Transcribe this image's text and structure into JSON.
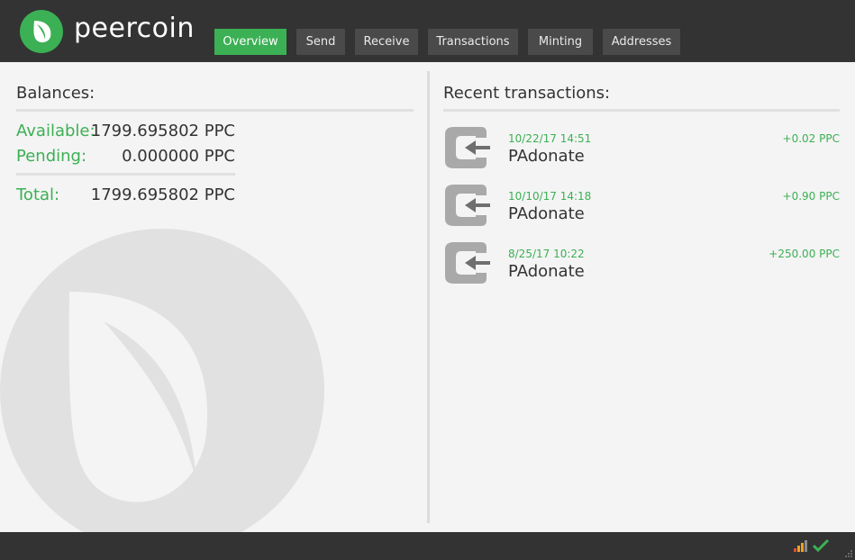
{
  "app": {
    "brand": "peercoin"
  },
  "nav": {
    "tabs": [
      {
        "label": "Overview",
        "active": true
      },
      {
        "label": "Send",
        "active": false
      },
      {
        "label": "Receive",
        "active": false
      },
      {
        "label": "Transactions",
        "active": false
      },
      {
        "label": "Minting",
        "active": false
      },
      {
        "label": "Addresses",
        "active": false
      }
    ]
  },
  "balances": {
    "title": "Balances:",
    "available_label": "Available:",
    "available_value": "1799.695802 PPC",
    "pending_label": "Pending:",
    "pending_value": "0.000000 PPC",
    "total_label": "Total:",
    "total_value": "1799.695802 PPC"
  },
  "recent": {
    "title": "Recent transactions:",
    "items": [
      {
        "date": "10/22/17 14:51",
        "label": "PAdonate",
        "amount": "+0.02 PPC",
        "icon": "receive-icon"
      },
      {
        "date": "10/10/17 14:18",
        "label": "PAdonate",
        "amount": "+0.90 PPC",
        "icon": "receive-icon"
      },
      {
        "date": "8/25/17 10:22",
        "label": "PAdonate",
        "amount": "+250.00 PPC",
        "icon": "receive-icon"
      }
    ]
  },
  "status": {
    "icons": [
      "network-signal-icon",
      "synced-check-icon"
    ]
  },
  "colors": {
    "accent": "#3cb054",
    "header_bg": "#333333",
    "tab_bg": "#4a4a4a",
    "content_bg": "#f4f4f4"
  }
}
